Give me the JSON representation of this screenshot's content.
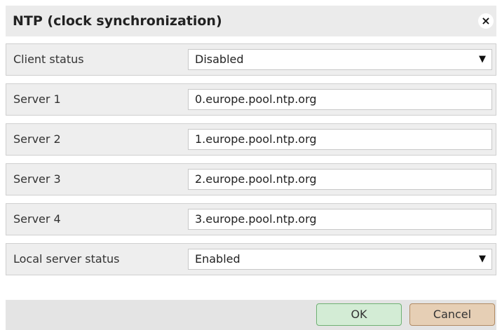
{
  "dialog": {
    "title": "NTP (clock synchronization)",
    "close_glyph": "×",
    "close_icon": "close-icon"
  },
  "rows": [
    {
      "label": "Client status",
      "value": "Disabled",
      "type": "select"
    },
    {
      "label": "Server 1",
      "value": "0.europe.pool.ntp.org",
      "type": "text"
    },
    {
      "label": "Server 2",
      "value": "1.europe.pool.ntp.org",
      "type": "text"
    },
    {
      "label": "Server 3",
      "value": "2.europe.pool.ntp.org",
      "type": "text"
    },
    {
      "label": "Server 4",
      "value": "3.europe.pool.ntp.org",
      "type": "text"
    },
    {
      "label": "Local server status",
      "value": "Enabled",
      "type": "select"
    }
  ],
  "dropdown_glyph": "▼",
  "footer": {
    "ok_label": "OK",
    "cancel_label": "Cancel"
  },
  "colors": {
    "title_bar": "#ebebeb",
    "row_background": "#eeeeee",
    "ok_button": "#d3ecd5",
    "cancel_button": "#e6cfb5"
  }
}
